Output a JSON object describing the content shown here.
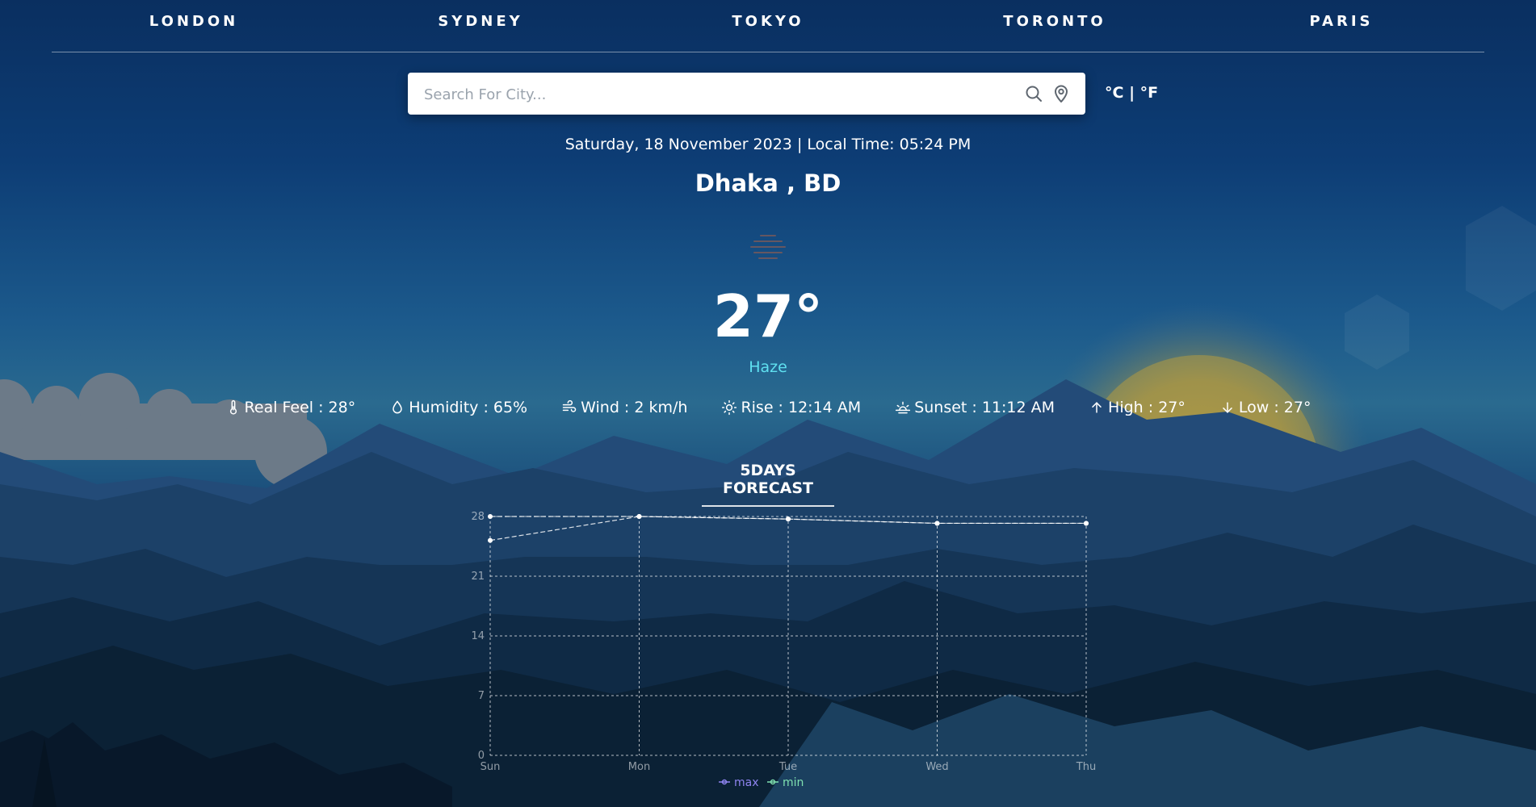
{
  "nav": {
    "cities": [
      "LONDON",
      "SYDNEY",
      "TOKYO",
      "TORONTO",
      "PARIS"
    ]
  },
  "search": {
    "placeholder": "Search For City...",
    "value": ""
  },
  "units": {
    "celsius": "°C",
    "separator": " | ",
    "fahrenheit": "°F"
  },
  "weather": {
    "datetime": "Saturday, 18 November 2023 | Local Time: 05:24 PM",
    "city": "Dhaka , BD",
    "temperature": "27°",
    "condition": "Haze",
    "condition_icon": "haze-icon",
    "details": [
      {
        "icon": "thermometer-icon",
        "text": "Real Feel : 28°"
      },
      {
        "icon": "droplet-icon",
        "text": "Humidity : 65%"
      },
      {
        "icon": "wind-icon",
        "text": "Wind : 2 km/h"
      },
      {
        "icon": "sunrise-icon",
        "text": "Rise : 12:14 AM"
      },
      {
        "icon": "sunset-icon",
        "text": "Sunset : 11:12 AM"
      },
      {
        "icon": "arrow-up-icon",
        "text": "High : 27°"
      },
      {
        "icon": "arrow-down-icon",
        "text": "Low : 27°"
      }
    ]
  },
  "forecast": {
    "title": "5DAYS FORECAST"
  },
  "colors": {
    "condition_accent": "#5fe0f0",
    "max_series": "#8f84f0",
    "min_series": "#7fe0b0"
  },
  "chart_data": {
    "type": "line",
    "categories": [
      "Sun",
      "Mon",
      "Tue",
      "Wed",
      "Thu"
    ],
    "series": [
      {
        "name": "max",
        "values": [
          28,
          28,
          27.7,
          27.2,
          27.2
        ]
      },
      {
        "name": "min",
        "values": [
          25.2,
          28,
          27.7,
          27.2,
          27.2
        ]
      }
    ],
    "yticks": [
      0,
      7,
      14,
      21,
      28
    ],
    "ylim": [
      0,
      28
    ],
    "grid": true,
    "legend": "bottom"
  }
}
